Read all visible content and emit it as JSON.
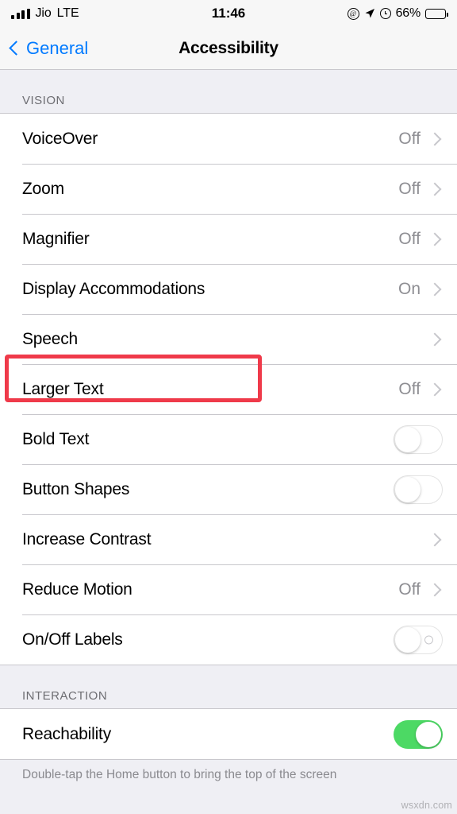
{
  "status_bar": {
    "carrier": "Jio",
    "radio": "LTE",
    "time": "11:46",
    "battery_percent": "66%",
    "battery_level": 66,
    "icons": [
      "signal-bars-icon",
      "at-circle-icon",
      "location-arrow-icon",
      "alarm-clock-icon",
      "battery-icon"
    ]
  },
  "nav": {
    "back_label": "General",
    "title": "Accessibility"
  },
  "sections": [
    {
      "header": "VISION",
      "rows": [
        {
          "label": "VoiceOver",
          "value": "Off",
          "accessory": "chevron"
        },
        {
          "label": "Zoom",
          "value": "Off",
          "accessory": "chevron"
        },
        {
          "label": "Magnifier",
          "value": "Off",
          "accessory": "chevron"
        },
        {
          "label": "Display Accommodations",
          "value": "On",
          "accessory": "chevron",
          "highlighted": true
        },
        {
          "label": "Speech",
          "value": "",
          "accessory": "chevron"
        },
        {
          "label": "Larger Text",
          "value": "Off",
          "accessory": "chevron"
        },
        {
          "label": "Bold Text",
          "value": "",
          "accessory": "toggle-off"
        },
        {
          "label": "Button Shapes",
          "value": "",
          "accessory": "toggle-off"
        },
        {
          "label": "Increase Contrast",
          "value": "",
          "accessory": "chevron"
        },
        {
          "label": "Reduce Motion",
          "value": "Off",
          "accessory": "chevron"
        },
        {
          "label": "On/Off Labels",
          "value": "",
          "accessory": "toggle-off-labeled"
        }
      ]
    },
    {
      "header": "INTERACTION",
      "rows": [
        {
          "label": "Reachability",
          "value": "",
          "accessory": "toggle-on"
        }
      ],
      "footnote": "Double-tap the Home button to bring the top of the screen"
    }
  ],
  "watermark": "wsxdn.com",
  "colors": {
    "accent": "#007aff",
    "toggle_on": "#4cd964",
    "highlight": "#ef3a4a",
    "group_bg": "#efeff4",
    "value_text": "#8e8e93"
  }
}
